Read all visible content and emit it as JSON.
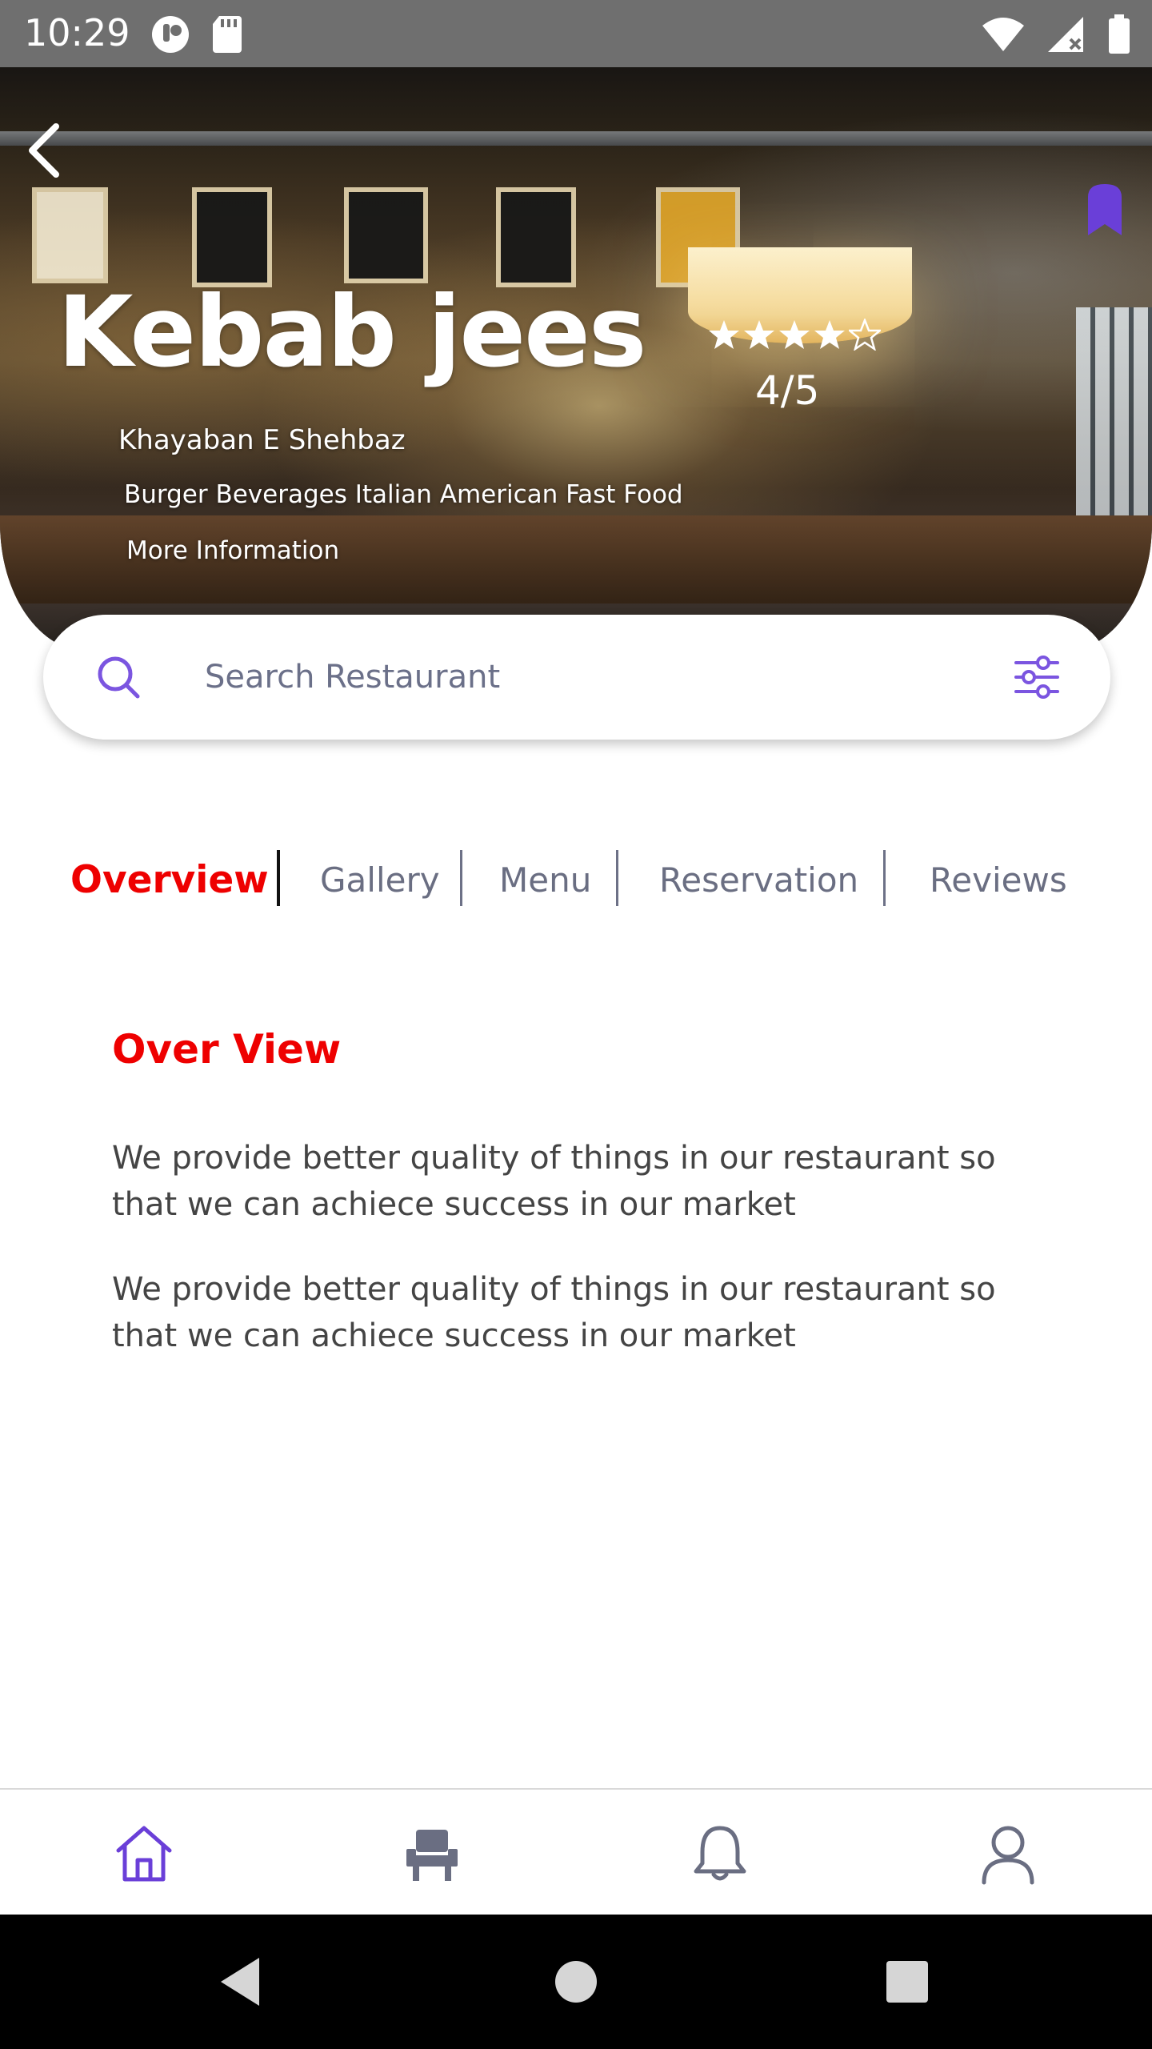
{
  "status_bar": {
    "time": "10:29",
    "left_icons": [
      "app-notification-icon",
      "sd-card-icon"
    ],
    "right_icons": [
      "wifi-icon",
      "cellular-signal-icon",
      "battery-icon"
    ]
  },
  "hero": {
    "name": "Kebab jees",
    "rating_value": 4,
    "rating_max": 5,
    "rating_text": "4/5",
    "address": "Khayaban E Shehbaz",
    "cuisines": "Burger Beverages Italian American Fast Food",
    "more_info_label": "More Information",
    "bookmark_color": "#6a3fd8"
  },
  "search": {
    "placeholder": "Search Restaurant",
    "value": ""
  },
  "tabs": [
    {
      "label": "Overview",
      "active": true
    },
    {
      "label": "Gallery",
      "active": false
    },
    {
      "label": "Menu",
      "active": false
    },
    {
      "label": "Reservation",
      "active": false
    },
    {
      "label": "Reviews",
      "active": false
    }
  ],
  "content": {
    "title": "Over View",
    "paragraphs": [
      "We provide better quality of things in our restaurant so that we can achiece success in our market",
      "We provide better quality of things in our restaurant so that we can achiece success in our market"
    ]
  },
  "bottom_nav": {
    "items": [
      "home-icon",
      "chair-icon",
      "bell-icon",
      "user-icon"
    ],
    "active_item": "home-icon"
  },
  "colors": {
    "accent_red": "#ee0000",
    "accent_purple": "#6a3fd8",
    "icon_gray": "#6a6e82"
  }
}
